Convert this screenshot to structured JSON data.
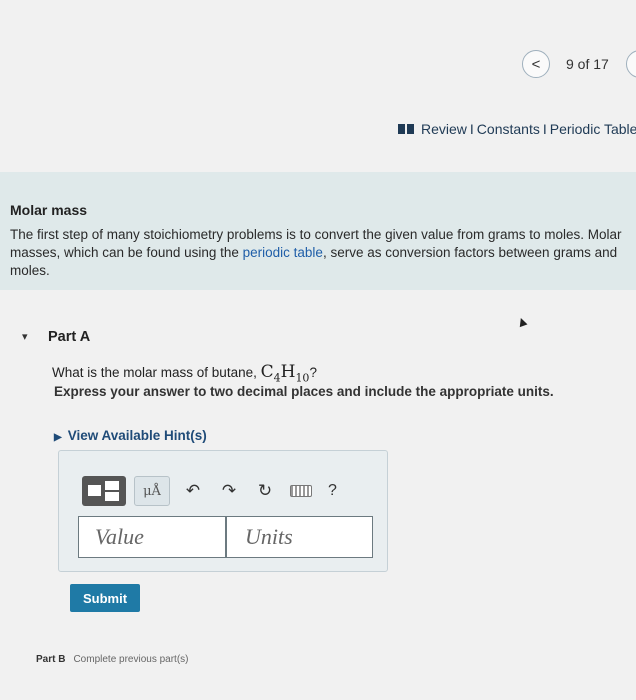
{
  "pagination": {
    "prev_glyph": "<",
    "position_text": "9 of 17"
  },
  "resources": {
    "review": "Review",
    "constants": "Constants",
    "periodic_table": "Periodic Table",
    "separator": "I"
  },
  "intro": {
    "title": "Molar mass",
    "text_before_link": "The first step of many stoichiometry problems is to convert the given value from grams to moles. Molar masses, which can be found using the ",
    "link_text": "periodic table",
    "text_after_link": ", serve as conversion factors between grams and moles."
  },
  "part_a": {
    "toggle_glyph": "▾",
    "title": "Part A",
    "question_prefix": "What is the molar mass of butane, ",
    "formula": {
      "c": "C",
      "c_sub": "4",
      "h": "H",
      "h_sub": "10"
    },
    "question_suffix": "?",
    "instruction": "Express your answer to two decimal places and include the appropriate units.",
    "hints_glyph": "▶",
    "hints_label": "View Available Hint(s)"
  },
  "toolbar": {
    "units_label": "μÅ",
    "undo_glyph": "↶",
    "redo_glyph": "↷",
    "reset_glyph": "↻",
    "help_label": "?"
  },
  "answer": {
    "value_placeholder": "Value",
    "units_placeholder": "Units",
    "submit_label": "Submit"
  },
  "part_b": {
    "label": "Part B",
    "status": "Complete previous part(s)"
  }
}
